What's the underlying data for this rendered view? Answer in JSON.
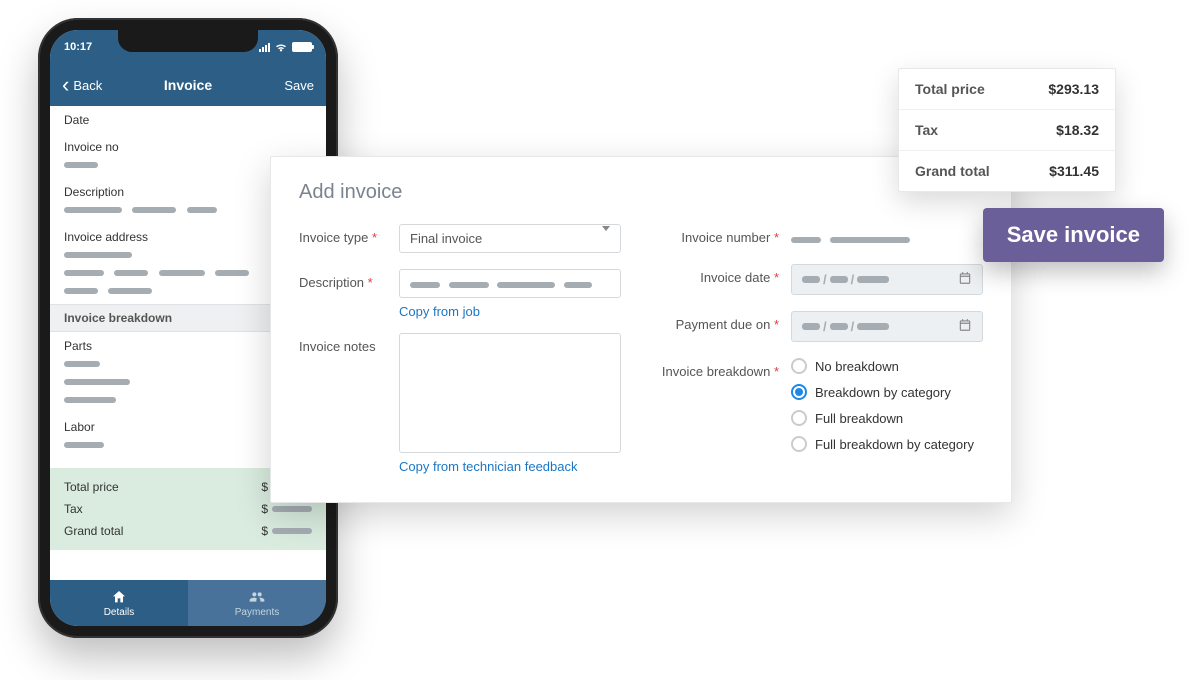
{
  "phone": {
    "time": "10:17",
    "back": "Back",
    "title": "Invoice",
    "save": "Save",
    "fields": {
      "date": "Date",
      "invoice_no": "Invoice no",
      "description": "Description",
      "invoice_address": "Invoice address",
      "invoice_breakdown": "Invoice breakdown",
      "parts": "Parts",
      "labor": "Labor"
    },
    "totals": {
      "total_price": "Total price",
      "tax": "Tax",
      "grand_total": "Grand total",
      "currency": "$"
    },
    "tabs": {
      "details": "Details",
      "payments": "Payments"
    }
  },
  "panel": {
    "title": "Add invoice",
    "labels": {
      "invoice_type": "Invoice type",
      "description": "Description",
      "invoice_notes": "Invoice notes",
      "invoice_number": "Invoice number",
      "invoice_date": "Invoice date",
      "payment_due": "Payment due on",
      "invoice_breakdown": "Invoice breakdown"
    },
    "invoice_type_value": "Final invoice",
    "links": {
      "copy_from_job": "Copy from job",
      "copy_from_tech": "Copy from technician feedback"
    },
    "breakdown_options": {
      "none": "No breakdown",
      "by_category": "Breakdown by category",
      "full": "Full breakdown",
      "full_by_category": "Full breakdown by category"
    }
  },
  "totals_card": {
    "rows": {
      "total_price_label": "Total price",
      "total_price_value": "$293.13",
      "tax_label": "Tax",
      "tax_value": "$18.32",
      "grand_total_label": "Grand total",
      "grand_total_value": "$311.45"
    }
  },
  "save_invoice_button": "Save invoice"
}
